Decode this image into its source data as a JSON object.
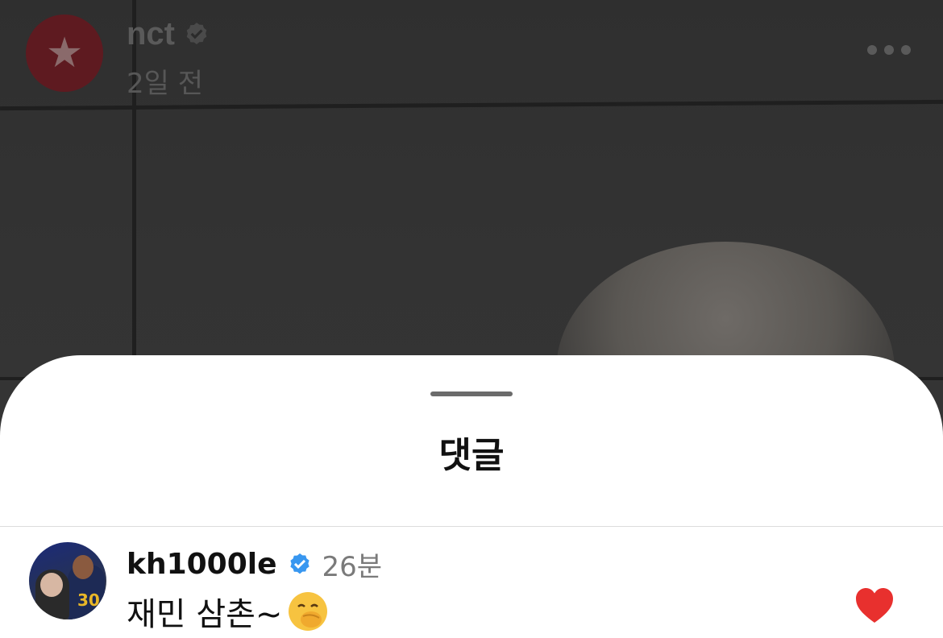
{
  "post": {
    "username": "nct",
    "time": "2일 전",
    "avatar_icon": "nct-logo-icon",
    "verified_icon": "verified-badge-icon",
    "more_icon": "more-horizontal-icon"
  },
  "sheet": {
    "title": "댓글"
  },
  "comments": [
    {
      "username": "kh1000le",
      "time": "26분",
      "text": "재민 삼촌~",
      "emoji": "face-with-hand-over-mouth-emoji",
      "liked": true,
      "like_icon": "heart-icon"
    }
  ],
  "colors": {
    "verified_blue": "#3897f0",
    "heart_red": "#e8302e",
    "nct_red": "#5e1a20"
  }
}
